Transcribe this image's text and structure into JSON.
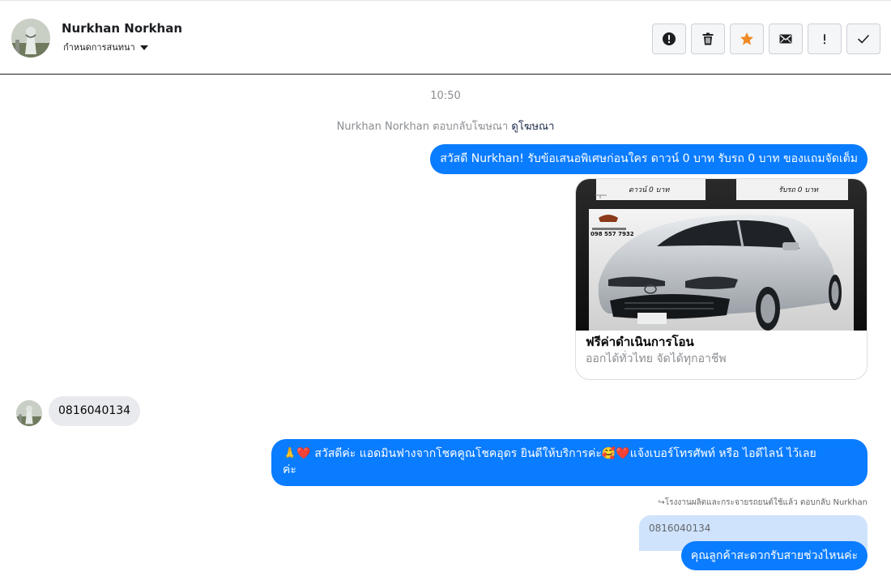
{
  "header": {
    "contact_name": "Nurkhan Norkhan",
    "conversation_label": "กำหนดการสนทนา",
    "toolbar": [
      {
        "id": "report",
        "icon": "alert-circle-icon"
      },
      {
        "id": "delete",
        "icon": "trash-icon"
      },
      {
        "id": "star",
        "icon": "star-icon"
      },
      {
        "id": "mark-unread",
        "icon": "envelope-icon"
      },
      {
        "id": "important",
        "icon": "exclamation-icon"
      },
      {
        "id": "done",
        "icon": "checkmark-icon"
      }
    ]
  },
  "colors": {
    "outgoing_bubble": "#0a7cff",
    "incoming_bubble": "#e9eaed",
    "quoted_bubble": "#cfe3fc",
    "star": "#f08a24"
  },
  "thread": {
    "timestamp": "10:50",
    "ad_reply_note": {
      "text": "Nurkhan Norkhan ตอบกลับโฆษณา",
      "link": "ดูโฆษณา"
    },
    "messages": [
      {
        "direction": "outgoing",
        "text": "สวัสดี Nurkhan! รับข้อเสนอพิเศษก่อนใคร ดาวน์ 0 บาท รับรถ 0 บาท ของแถมจัดเต็ม"
      },
      {
        "direction": "outgoing",
        "type": "ad_card",
        "image": {
          "badge_left": "ดาวน์ 0 บาท",
          "badge_right": "รับรถ 0 บาท",
          "phone": "098 557 7932"
        },
        "title": "ฟรีค่าดำเนินการโอน",
        "subtitle": "ออกได้ทั่วไทย จัดได้ทุกอาชีพ"
      },
      {
        "direction": "incoming",
        "text": "0816040134"
      },
      {
        "direction": "outgoing",
        "lines": [
          "🙏❤️ สวัสดีค่ะ แอดมินฟางจากโชคคูณโชคอุดร ยินดีให้บริการค่ะ🥰❤️แจ้งเบอร์โทรศัพท์ หรือ ไอดีไลน์  ไว้เลย",
          "ค่ะ"
        ]
      },
      {
        "direction": "outgoing",
        "reply_note": "↪โรงงานผลิตและกระจายรถยนต์ใช้แล้ว ตอบกลับ Nurkhan",
        "quoted_text": "0816040134",
        "text": "คุณลูกค้าสะดวกรับสายช่วงไหนค่ะ"
      }
    ]
  }
}
